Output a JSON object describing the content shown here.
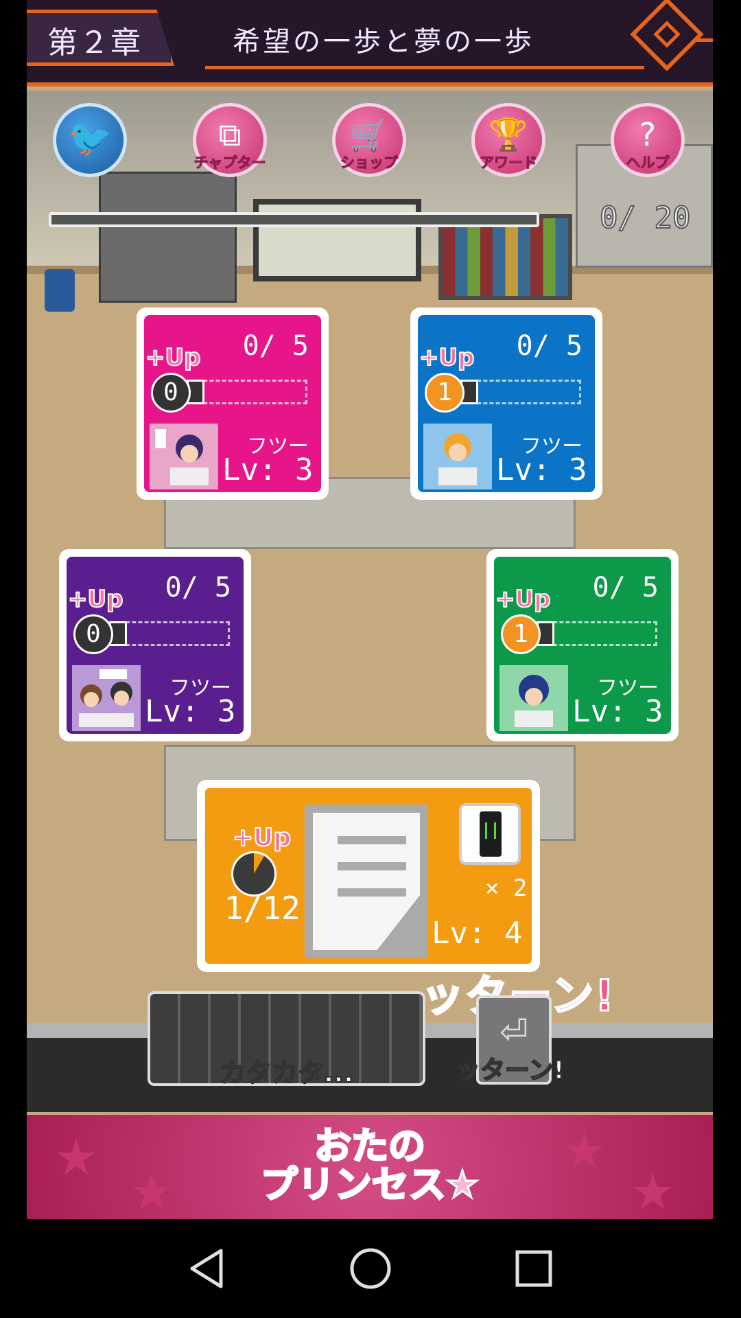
{
  "header": {
    "chapter": "第２章",
    "title": "希望の一歩と夢の一歩"
  },
  "top_icons": [
    {
      "name": "twitter",
      "label": "",
      "glyph": "🐦"
    },
    {
      "name": "chapter",
      "label": "チャプター",
      "glyph": "⧉"
    },
    {
      "name": "shop",
      "label": "ショップ",
      "glyph": "🛒"
    },
    {
      "name": "award",
      "label": "アワード",
      "glyph": "🏆"
    },
    {
      "name": "help",
      "label": "ヘルプ",
      "glyph": "?"
    }
  ],
  "progress": {
    "text": "0/ 20",
    "fraction": 0.0
  },
  "cards": [
    {
      "color": "#e6158a",
      "count": "0/ 5",
      "up": "+Up",
      "level_num": "0",
      "status": "フツー",
      "lv": "Lv: 3"
    },
    {
      "color": "#0b74c7",
      "count": "0/ 5",
      "up": "+Up",
      "level_num": "1",
      "status": "フツー",
      "lv": "Lv: 3"
    },
    {
      "color": "#5b1e8e",
      "count": "0/ 5",
      "up": "+Up",
      "level_num": "0",
      "status": "フツー",
      "lv": "Lv: 3"
    },
    {
      "color": "#0c9a4a",
      "count": "0/ 5",
      "up": "+Up",
      "level_num": "1",
      "status": "フツー",
      "lv": "Lv: 3"
    }
  ],
  "task": {
    "up": "+Up",
    "count": "1/12",
    "multiplier": "× 2",
    "lv": "Lv: 4"
  },
  "keyboard": {
    "label": "カタカタ..."
  },
  "enter": {
    "label": "ッターン!",
    "big": "ッターン!"
  },
  "banner": {
    "title_line1": "おたの",
    "title_line2": "プリンセス★"
  }
}
